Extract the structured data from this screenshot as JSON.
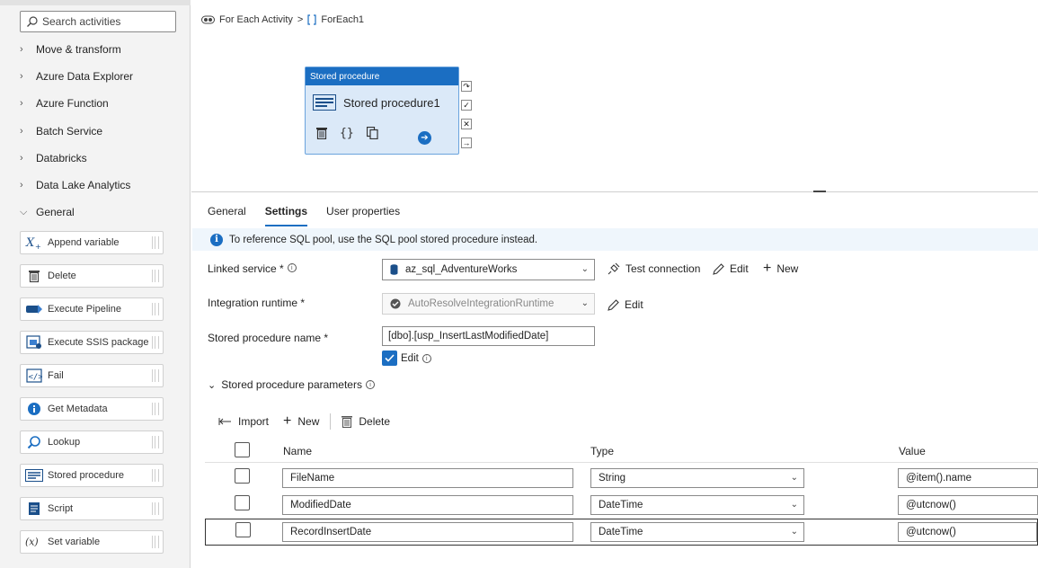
{
  "sidebar": {
    "search_placeholder": "Search activities",
    "categories": [
      {
        "label": "Move & transform",
        "expanded": false
      },
      {
        "label": "Azure Data Explorer",
        "expanded": false
      },
      {
        "label": "Azure Function",
        "expanded": false
      },
      {
        "label": "Batch Service",
        "expanded": false
      },
      {
        "label": "Databricks",
        "expanded": false
      },
      {
        "label": "Data Lake Analytics",
        "expanded": false
      },
      {
        "label": "General",
        "expanded": true
      }
    ],
    "activities": [
      {
        "label": "Append variable",
        "icon": "append-variable-icon"
      },
      {
        "label": "Delete",
        "icon": "trash-icon"
      },
      {
        "label": "Execute Pipeline",
        "icon": "execute-pipeline-icon"
      },
      {
        "label": "Execute SSIS package",
        "icon": "ssis-package-icon"
      },
      {
        "label": "Fail",
        "icon": "fail-icon"
      },
      {
        "label": "Get Metadata",
        "icon": "info-icon"
      },
      {
        "label": "Lookup",
        "icon": "lookup-icon"
      },
      {
        "label": "Stored procedure",
        "icon": "stored-procedure-icon"
      },
      {
        "label": "Script",
        "icon": "script-icon"
      },
      {
        "label": "Set variable",
        "icon": "set-variable-icon"
      }
    ]
  },
  "breadcrumb": {
    "parent": "For Each Activity",
    "separator": ">",
    "current": "ForEach1"
  },
  "canvas": {
    "node": {
      "type_label": "Stored procedure",
      "name": "Stored procedure1"
    }
  },
  "tabs": [
    {
      "label": "General",
      "active": false
    },
    {
      "label": "Settings",
      "active": true
    },
    {
      "label": "User properties",
      "active": false
    }
  ],
  "info_bar": {
    "message": "To reference SQL pool, use the SQL pool stored procedure instead."
  },
  "settings": {
    "linked_service": {
      "label": "Linked service *",
      "value": "az_sql_AdventureWorks",
      "test_connection_label": "Test connection",
      "edit_label": "Edit",
      "new_label": "New"
    },
    "integration_runtime": {
      "label": "Integration runtime *",
      "value": "AutoResolveIntegrationRuntime",
      "edit_label": "Edit"
    },
    "stored_procedure_name": {
      "label": "Stored procedure name *",
      "value": "[dbo].[usp_InsertLastModifiedDate]",
      "edit_label": "Edit",
      "edit_checked": true
    }
  },
  "parameters": {
    "section_label": "Stored procedure parameters",
    "toolbar": {
      "import_label": "Import",
      "new_label": "New",
      "delete_label": "Delete"
    },
    "columns": {
      "name": "Name",
      "type": "Type",
      "value": "Value"
    },
    "rows": [
      {
        "name": "FileName",
        "type": "String",
        "value": "@item().name",
        "selected": false
      },
      {
        "name": "ModifiedDate",
        "type": "DateTime",
        "value": "@utcnow()",
        "selected": false
      },
      {
        "name": "RecordInsertDate",
        "type": "DateTime",
        "value": "@utcnow()",
        "selected": true
      }
    ]
  },
  "colors": {
    "accent": "#1b6ec2",
    "info_bg": "#eff6fc",
    "node_bg": "#dbe9f8"
  }
}
